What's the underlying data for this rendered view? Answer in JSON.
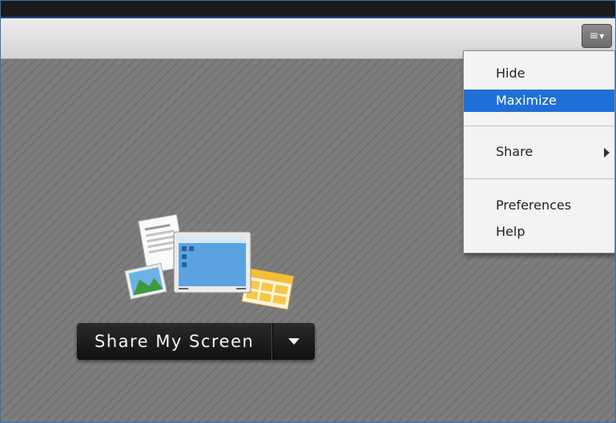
{
  "toolbar": {
    "menu_icon": "list-menu-icon",
    "caret_icon": "chevron-down-icon"
  },
  "share": {
    "main_label": "Share My Screen",
    "dropdown_icon": "caret-down-icon"
  },
  "illustration": {
    "icons": [
      "document-icon",
      "monitor-icon",
      "photo-icon",
      "spreadsheet-icon"
    ]
  },
  "menu": {
    "items": [
      {
        "label": "Hide"
      },
      {
        "label": "Maximize",
        "highlighted": true
      },
      {
        "label": "Share",
        "has_submenu": true
      },
      {
        "label": "Preferences"
      },
      {
        "label": "Help"
      }
    ]
  },
  "colors": {
    "highlight": "#1f6fd6",
    "frame_border": "#3b6fb0"
  }
}
